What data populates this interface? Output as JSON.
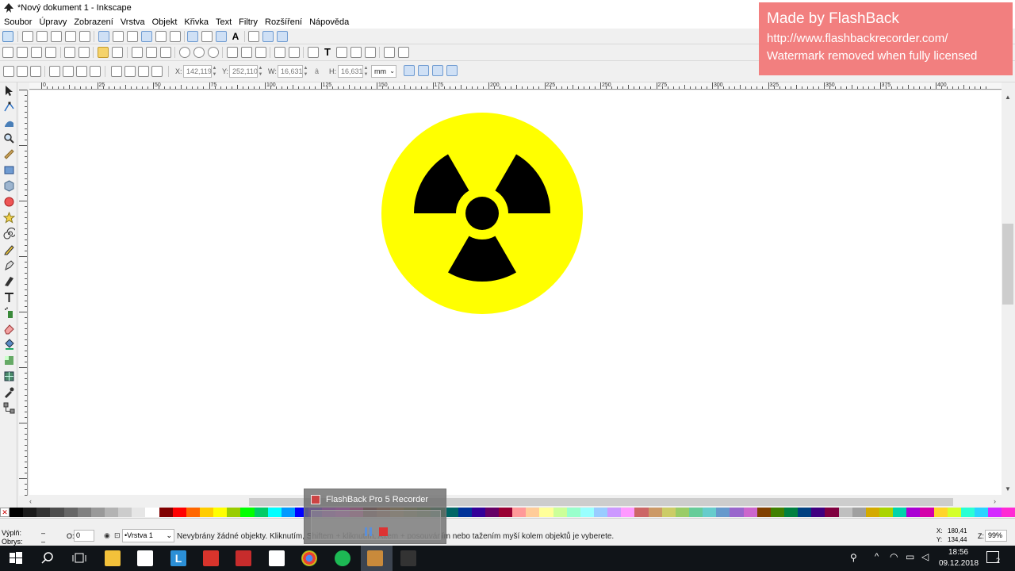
{
  "window": {
    "title": "*Nový dokument 1 - Inkscape",
    "minimize_label": "—",
    "maximize_label": "❐",
    "close_label": "✕"
  },
  "menu": [
    "Soubor",
    "Úpravy",
    "Zobrazení",
    "Vrstva",
    "Objekt",
    "Křivka",
    "Text",
    "Filtry",
    "Rozšíření",
    "Nápověda"
  ],
  "controls": {
    "x_label": "X:",
    "x_value": "142,119",
    "y_label": "Y:",
    "y_value": "252,110",
    "w_label": "W:",
    "w_value": "16,631",
    "h_label": "H:",
    "h_value": "16,631",
    "unit": "mm"
  },
  "ruler": {
    "top_labels": [
      "0",
      "25",
      "50",
      "75",
      "100",
      "125",
      "150",
      "175",
      "200",
      "225",
      "250",
      "275",
      "300",
      "325",
      "350",
      "375",
      "400"
    ]
  },
  "canvas": {
    "symbol_bg_color": "#ffff00",
    "symbol_fg_color": "#000000"
  },
  "palette": {
    "colors": [
      "#000000",
      "#1a1a1a",
      "#333333",
      "#4d4d4d",
      "#666666",
      "#808080",
      "#999999",
      "#b3b3b3",
      "#cccccc",
      "#e6e6e6",
      "#ffffff",
      "#800000",
      "#ff0000",
      "#ff6600",
      "#ffcc00",
      "#ffff00",
      "#99cc00",
      "#00ff00",
      "#00cc66",
      "#00ffff",
      "#0099ff",
      "#0000ff",
      "#6600ff",
      "#cc00ff",
      "#ff00ff",
      "#ff0099",
      "#660000",
      "#993300",
      "#996600",
      "#666600",
      "#336600",
      "#006633",
      "#006666",
      "#003399",
      "#330099",
      "#660066",
      "#990033",
      "#ff9999",
      "#ffcc99",
      "#ffff99",
      "#ccff99",
      "#99ffcc",
      "#99ffff",
      "#99ccff",
      "#cc99ff",
      "#ff99ff",
      "#cc6666",
      "#cc9966",
      "#cccc66",
      "#99cc66",
      "#66cc99",
      "#66cccc",
      "#6699cc",
      "#9966cc",
      "#cc66cc",
      "#804000",
      "#408000",
      "#008040",
      "#004080",
      "#400080",
      "#800040",
      "#bfbfbf",
      "#a0a0a0",
      "#d4aa00",
      "#aad400",
      "#00d4aa",
      "#aa00d4",
      "#d400aa",
      "#ffd42a",
      "#d4ff2a",
      "#2affd4",
      "#2ad4ff",
      "#d42aff",
      "#ff2ad4"
    ]
  },
  "status": {
    "fill_label": "Výplň:",
    "fill_value": "–",
    "stroke_label": "Obrys:",
    "stroke_value": "–",
    "opacity_label": "O:",
    "opacity_value": "0",
    "layer": "•Vrstva 1",
    "message": "Nevybrány žádné objekty. Kliknutím, Shiftem + kliknutím, Altem + posouváním nebo tažením myší kolem objektů je vyberete.",
    "cursor_x_label": "X:",
    "cursor_x": "180,41",
    "cursor_y_label": "Y:",
    "cursor_y": "134,44",
    "zoom_label": "Z:",
    "zoom": "99%"
  },
  "watermark": {
    "line1": "Made by FlashBack",
    "line2": "http://www.flashbackrecorder.com/",
    "line3": "Watermark removed when fully licensed"
  },
  "recorder": {
    "title": "FlashBack Pro 5 Recorder"
  },
  "taskbar": {
    "time": "18:56",
    "date": "09.12.2018",
    "notification_count": "2"
  }
}
